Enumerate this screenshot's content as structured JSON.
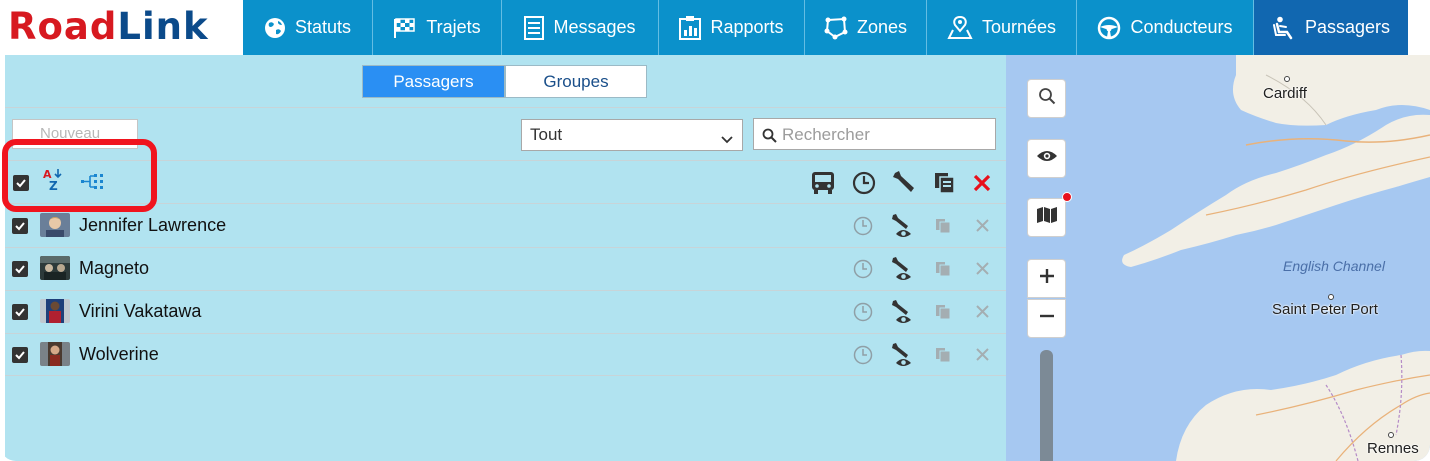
{
  "app": {
    "brand": {
      "part1": "Road",
      "part2": "Link"
    }
  },
  "nav": {
    "tabs": [
      {
        "label": "Statuts",
        "icon": "globe-icon",
        "active": false
      },
      {
        "label": "Trajets",
        "icon": "checkered-flag-icon",
        "active": false
      },
      {
        "label": "Messages",
        "icon": "message-icon",
        "active": false
      },
      {
        "label": "Rapports",
        "icon": "report-icon",
        "active": false
      },
      {
        "label": "Zones",
        "icon": "zone-polygon-icon",
        "active": false
      },
      {
        "label": "Tournées",
        "icon": "route-map-icon",
        "active": false
      },
      {
        "label": "Conducteurs",
        "icon": "steering-wheel-icon",
        "active": false
      },
      {
        "label": "Passagers",
        "icon": "passenger-seat-icon",
        "active": true
      }
    ]
  },
  "segments": {
    "passagers": "Passagers",
    "groupes": "Groupes",
    "selected": "passagers"
  },
  "toolbar": {
    "new_button": "Nouveau",
    "filter": {
      "selected": "Tout"
    },
    "search": {
      "placeholder": "Rechercher",
      "value": ""
    },
    "header_icons": [
      "select-all-checkbox",
      "sort-az-icon",
      "group-hierarchy-icon",
      "bus-icon",
      "clock-icon",
      "wrench-icon",
      "copy-icon",
      "delete-icon"
    ]
  },
  "passengers": [
    {
      "name": "Jennifer Lawrence",
      "checked": true
    },
    {
      "name": "Magneto",
      "checked": true
    },
    {
      "name": "Virini Vakatawa",
      "checked": true
    },
    {
      "name": "Wolverine",
      "checked": true
    }
  ],
  "map": {
    "labels": {
      "cardiff": "Cardiff",
      "english_channel": "English Channel",
      "saint_peter_port": "Saint Peter Port",
      "rennes": "Rennes"
    },
    "controls": [
      "search-icon",
      "eye-icon",
      "map-layers-icon",
      "zoom-in",
      "zoom-out"
    ]
  },
  "colors": {
    "nav_bg": "#0b91cb",
    "nav_active": "#1167b0",
    "panel_bg": "#b1e3f0",
    "segment_active": "#2a8ff3",
    "brand_red": "#d71920",
    "brand_blue": "#0b4a8a",
    "delete_red": "#e8101c",
    "highlight_red": "#f0141e",
    "sea": "#a6c8f1",
    "land": "#f2efe6"
  }
}
